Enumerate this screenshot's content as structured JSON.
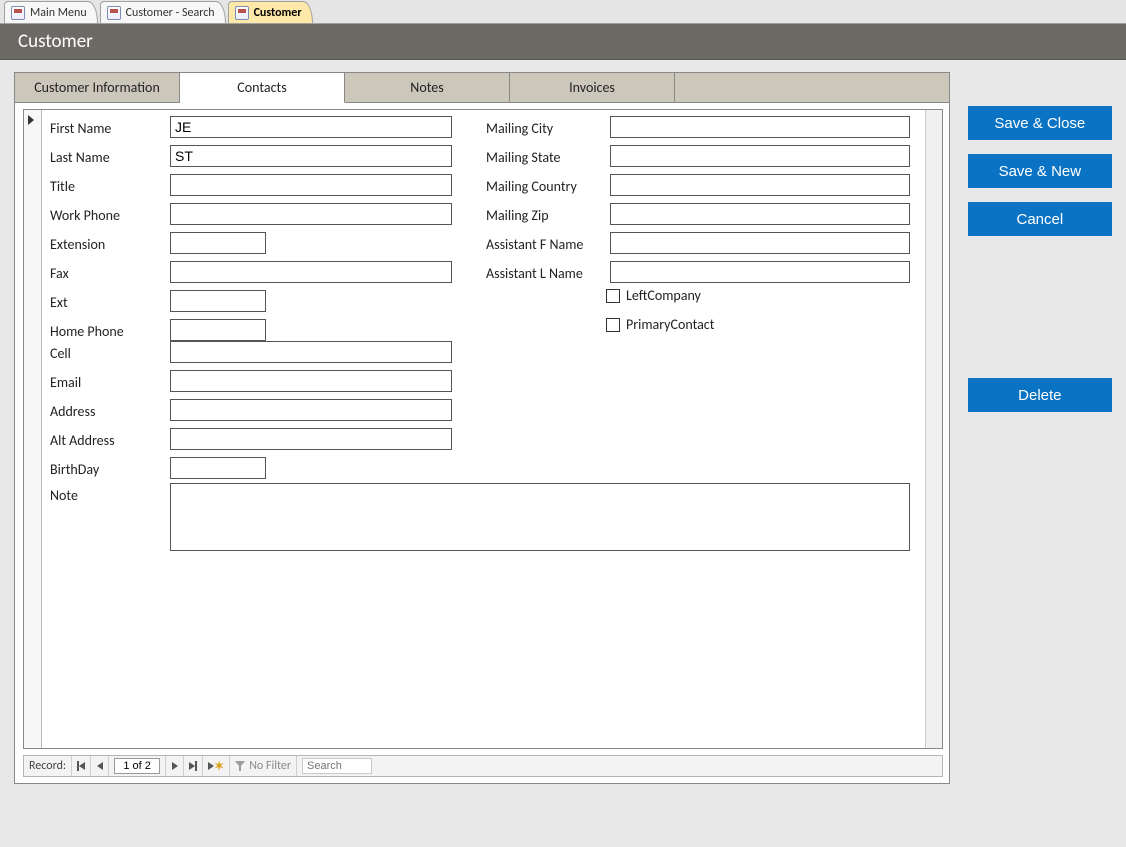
{
  "doctabs": {
    "items": [
      {
        "label": "Main Menu",
        "active": false
      },
      {
        "label": "Customer - Search",
        "active": false
      },
      {
        "label": "Customer",
        "active": true
      }
    ]
  },
  "header": {
    "title": "Customer"
  },
  "subtabs": {
    "items": [
      {
        "label": "Customer Information",
        "active": false
      },
      {
        "label": "Contacts",
        "active": true
      },
      {
        "label": "Notes",
        "active": false
      },
      {
        "label": "Invoices",
        "active": false
      }
    ]
  },
  "fields": {
    "left": {
      "first_name": {
        "label": "First Name",
        "value": "JE"
      },
      "last_name": {
        "label": "Last Name",
        "value": "ST"
      },
      "title": {
        "label": "Title",
        "value": ""
      },
      "work_phone": {
        "label": "Work Phone",
        "value": ""
      },
      "extension": {
        "label": "Extension",
        "value": ""
      },
      "fax": {
        "label": "Fax",
        "value": ""
      },
      "ext": {
        "label": "Ext",
        "value": ""
      },
      "home_phone": {
        "label": "Home Phone",
        "value": ""
      },
      "cell": {
        "label": "Cell",
        "value": ""
      },
      "email": {
        "label": "Email",
        "value": ""
      },
      "address": {
        "label": "Address",
        "value": ""
      },
      "alt_address": {
        "label": "Alt Address",
        "value": ""
      },
      "birthday": {
        "label": "BirthDay",
        "value": ""
      },
      "note": {
        "label": "Note",
        "value": ""
      }
    },
    "right": {
      "mailing_city": {
        "label": "Mailing City",
        "value": ""
      },
      "mailing_state": {
        "label": "Mailing State",
        "value": ""
      },
      "mailing_country": {
        "label": "Mailing Country",
        "value": ""
      },
      "mailing_zip": {
        "label": "Mailing Zip",
        "value": ""
      },
      "assistant_f_name": {
        "label": "Assistant F Name",
        "value": ""
      },
      "assistant_l_name": {
        "label": "Assistant L Name",
        "value": ""
      },
      "left_company": {
        "label": "LeftCompany",
        "checked": false
      },
      "primary_contact": {
        "label": "PrimaryContact",
        "checked": false
      }
    }
  },
  "recordnav": {
    "label": "Record:",
    "position": "1 of 2",
    "filter_label": "No Filter",
    "search_placeholder": "Search"
  },
  "actions": {
    "save_close": "Save & Close",
    "save_new": "Save & New",
    "cancel": "Cancel",
    "delete": "Delete"
  }
}
